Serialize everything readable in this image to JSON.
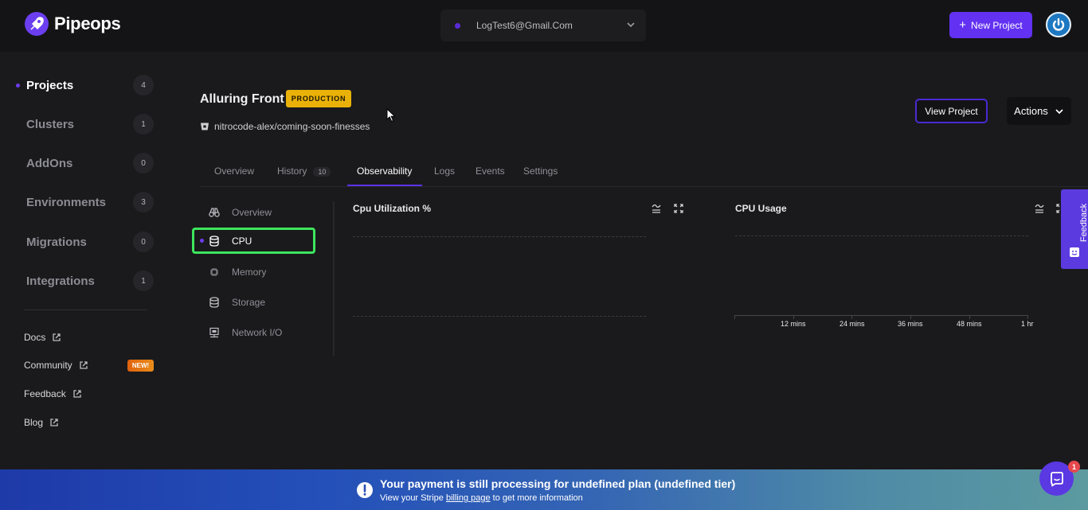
{
  "app": {
    "name": "Pipeops"
  },
  "account": {
    "email": "LogTest6@Gmail.Com"
  },
  "header": {
    "new_project_label": "New Project"
  },
  "sidebar": {
    "items": [
      {
        "label": "Projects",
        "count": "4",
        "active": true
      },
      {
        "label": "Clusters",
        "count": "1"
      },
      {
        "label": "AddOns",
        "count": "0"
      },
      {
        "label": "Environments",
        "count": "3"
      },
      {
        "label": "Migrations",
        "count": "0"
      },
      {
        "label": "Integrations",
        "count": "1"
      }
    ],
    "links": [
      {
        "label": "Docs"
      },
      {
        "label": "Community",
        "badge": "NEW!"
      },
      {
        "label": "Feedback"
      },
      {
        "label": "Blog"
      }
    ]
  },
  "project": {
    "title": "Alluring Front",
    "env_badge": "PRODUCTION",
    "repo": "nitrocode-alex/coming-soon-finesses",
    "view_label": "View Project",
    "actions_label": "Actions"
  },
  "tabs": [
    {
      "label": "Overview"
    },
    {
      "label": "History",
      "count": "10"
    },
    {
      "label": "Observability",
      "active": true
    },
    {
      "label": "Logs"
    },
    {
      "label": "Events"
    },
    {
      "label": "Settings"
    }
  ],
  "observability_menu": [
    {
      "label": "Overview",
      "icon": "binoculars-icon"
    },
    {
      "label": "CPU",
      "icon": "database-icon",
      "active": true
    },
    {
      "label": "Memory",
      "icon": "chip-icon"
    },
    {
      "label": "Storage",
      "icon": "database-icon"
    },
    {
      "label": "Network I/O",
      "icon": "network-icon"
    }
  ],
  "charts": {
    "cpu_utilization": {
      "title": "Cpu Utilization %"
    },
    "cpu_usage": {
      "title": "CPU Usage",
      "x_ticks": [
        "12 mins",
        "24 mins",
        "36 mins",
        "48 mins",
        "1 hr"
      ]
    }
  },
  "feedback_tab": {
    "label": "Feedback"
  },
  "banner": {
    "title": "Your payment is still processing for undefined plan (undefined tier)",
    "sub_before": "View your Stripe",
    "sub_link": "billing page",
    "sub_after": "to get more information"
  },
  "chat": {
    "unread": "1"
  },
  "colors": {
    "accent": "#6231f2",
    "production": "#eab208",
    "active_outline": "#3ee55d"
  }
}
